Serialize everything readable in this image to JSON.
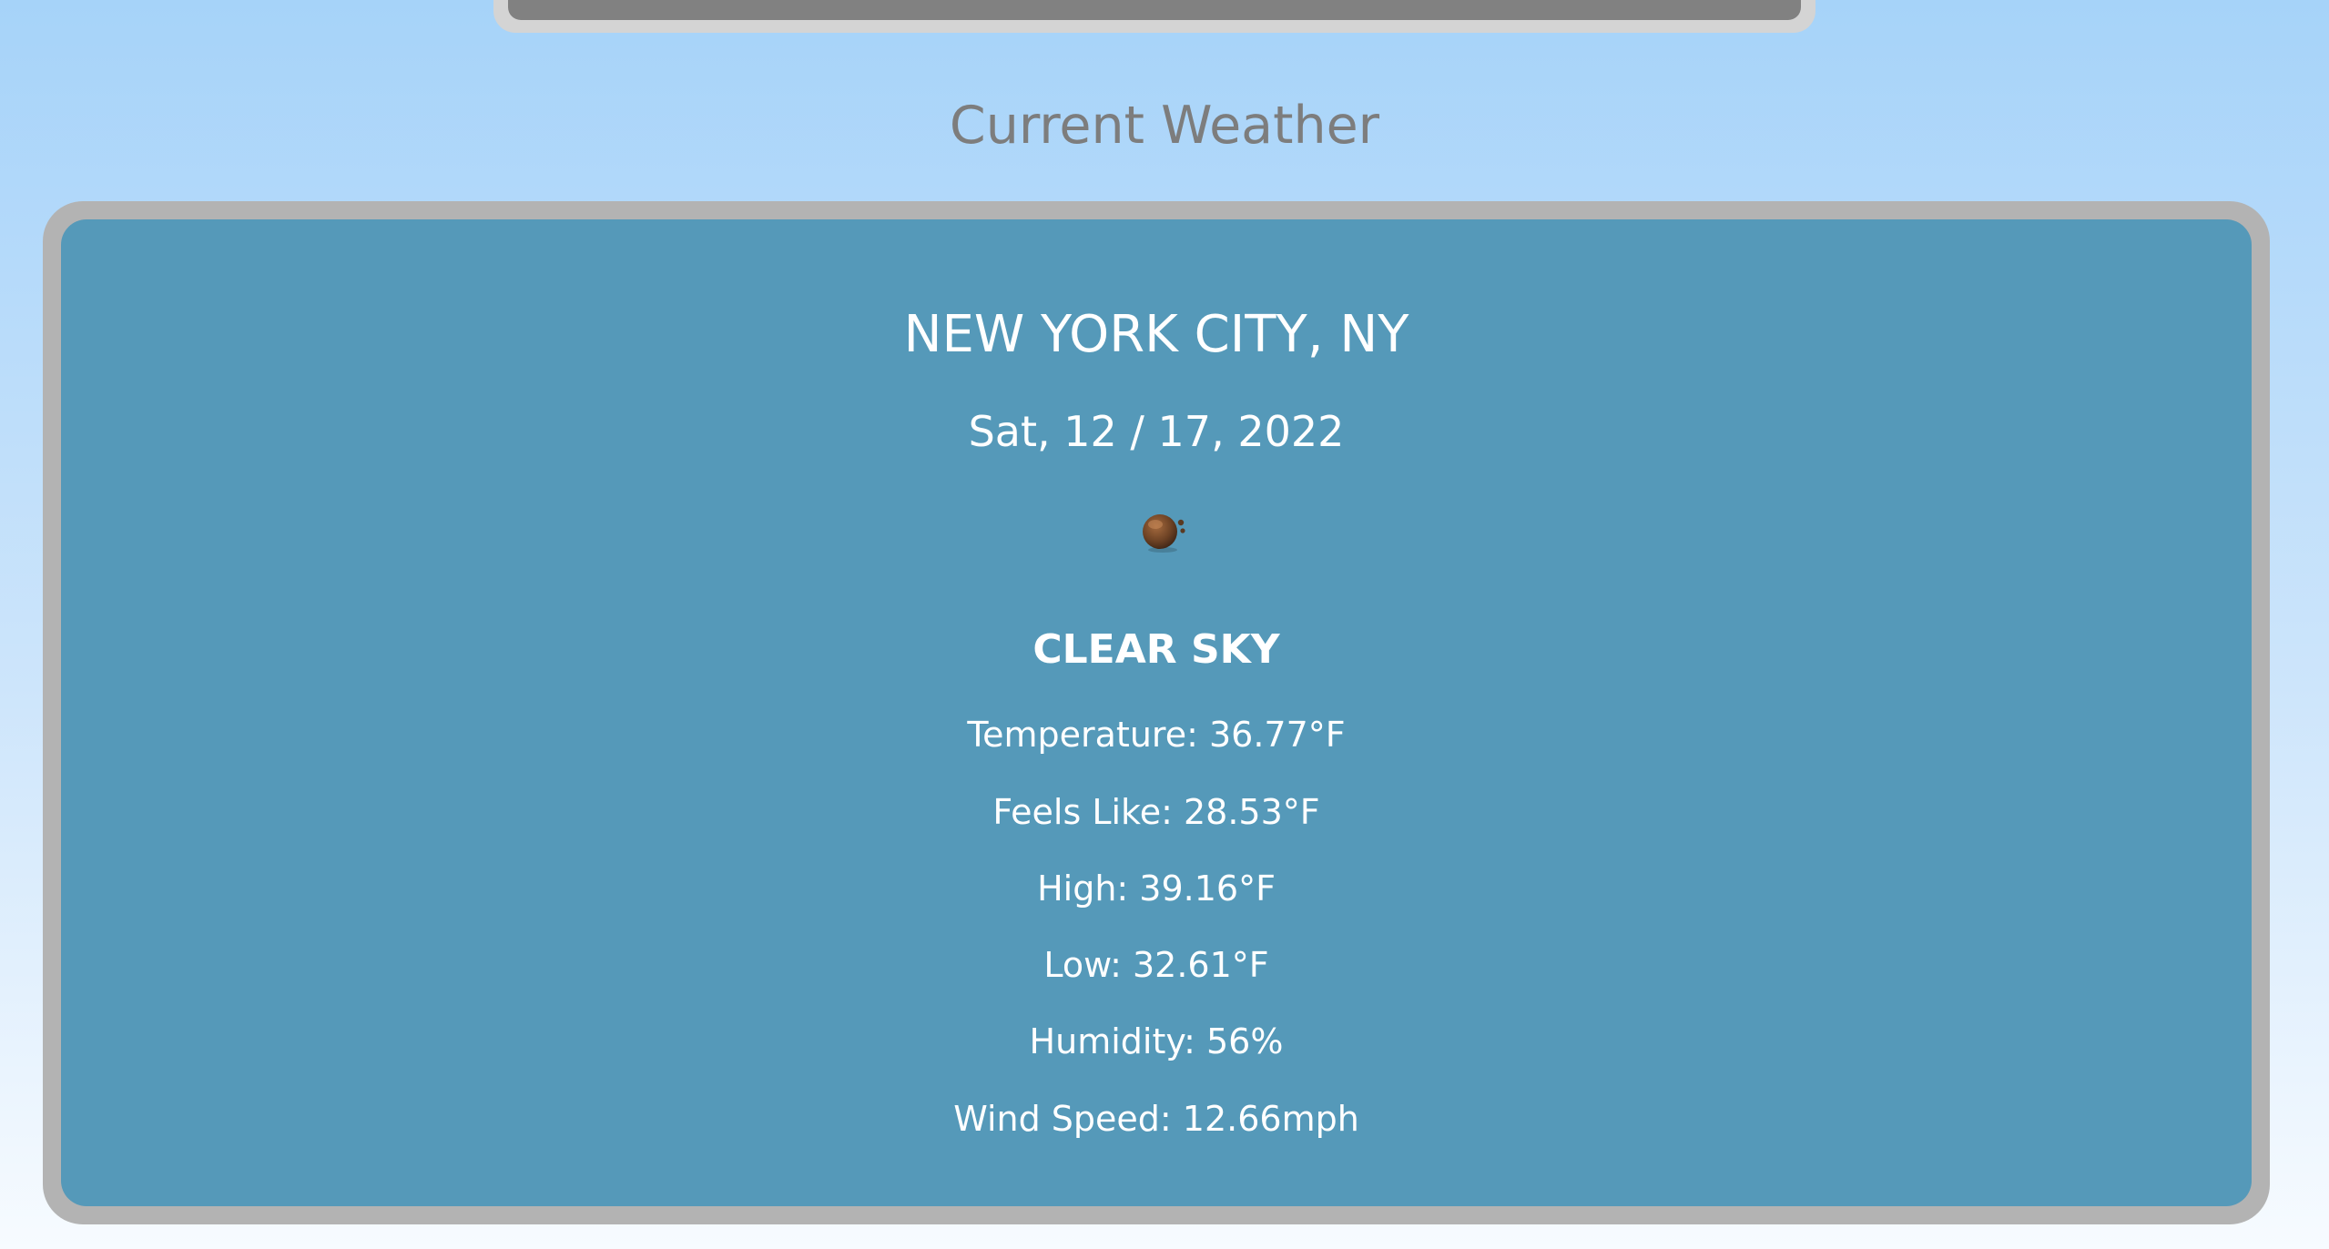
{
  "page": {
    "background_top_color": "#a6d3f9",
    "background_bottom_color": "#f7fbff"
  },
  "section": {
    "heading": "Current Weather"
  },
  "weather": {
    "city": "NEW YORK CITY, NY",
    "date": "Sat, 12 / 17, 2022",
    "icon": "weather-condition-icon",
    "description": "CLEAR SKY",
    "temperature": "Temperature: 36.77°F",
    "feels_like": "Feels Like: 28.53°F",
    "high": "High: 39.16°F",
    "low": "Low: 32.61°F",
    "humidity": "Humidity: 56%",
    "wind_speed": "Wind Speed: 12.66mph"
  },
  "colors": {
    "card_border": "#b3b3b3",
    "card_fill": "#5599b9",
    "heading_text": "#7d7d7d",
    "card_text": "#ffffff"
  }
}
